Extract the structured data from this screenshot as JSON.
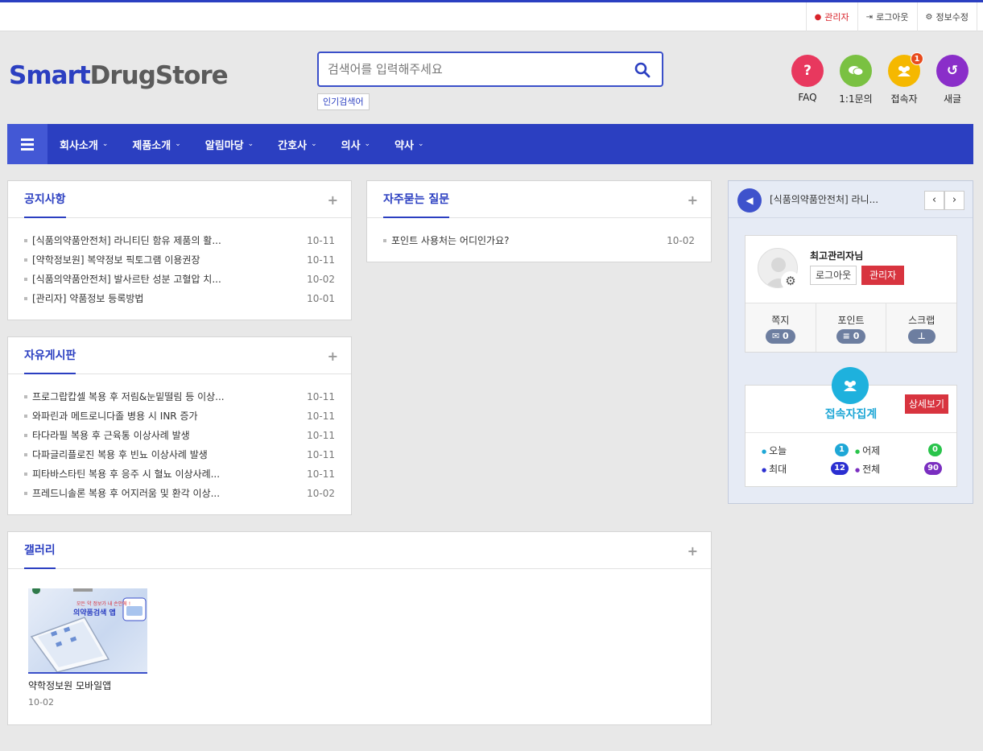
{
  "topbar": {
    "admin": "관리자",
    "logout": "로그아웃",
    "edit": "정보수정"
  },
  "logo": {
    "part1": "Smart",
    "part2": "DrugStore"
  },
  "search": {
    "placeholder": "검색어를 입력해주세요",
    "popular": "인기검색어"
  },
  "quick": [
    {
      "label": "FAQ",
      "glyph": "?",
      "color": "#e8385e"
    },
    {
      "label": "1:1문의",
      "glyph": "…",
      "color": "#7ac142"
    },
    {
      "label": "접속자",
      "glyph": "●●",
      "color": "#f5b800",
      "badge": "1"
    },
    {
      "label": "새글",
      "glyph": "↺",
      "color": "#8a2ec9"
    }
  ],
  "nav": {
    "items": [
      "회사소개",
      "제품소개",
      "알림마당",
      "간호사",
      "의사",
      "약사"
    ]
  },
  "notice": {
    "title": "공지사항",
    "rows": [
      {
        "t": "[식품의약품안전처] 라니티딘 함유 제품의 활...",
        "d": "10-11"
      },
      {
        "t": "[약학정보원] 복약정보 픽토그램 이용권장",
        "d": "10-11"
      },
      {
        "t": "[식품의약품안전처] 발사르탄 성분 고혈압 치...",
        "d": "10-02"
      },
      {
        "t": "[관리자] 약품정보 등록방법",
        "d": "10-01"
      }
    ]
  },
  "faq": {
    "title": "자주묻는 질문",
    "rows": [
      {
        "t": "포인트 사용처는 어디인가요?",
        "d": "10-02"
      }
    ]
  },
  "free": {
    "title": "자유게시판",
    "rows": [
      {
        "t": "프로그랍캅셀 복용 후 저림&눈밑떨림 등 이상...",
        "d": "10-11"
      },
      {
        "t": "와파린과 메트로니다졸 병용 시 INR 증가",
        "d": "10-11"
      },
      {
        "t": "타다라필 복용 후 근육통 이상사례 발생",
        "d": "10-11"
      },
      {
        "t": "다파글리플로진 복용 후 빈뇨 이상사례 발생",
        "d": "10-11"
      },
      {
        "t": "피타바스타틴 복용 후 응주 시 혈뇨 이상사례...",
        "d": "10-11"
      },
      {
        "t": "프레드니솔론 복용 후 어지러움 및 환각 이상...",
        "d": "10-02"
      }
    ]
  },
  "gallery": {
    "title": "갤러리",
    "item": {
      "caption": "약학정보원 모바일앱",
      "date": "10-02",
      "img_text1": "모든 약 정보가 내 손안에 !",
      "img_text2": "의약품검색 앱"
    }
  },
  "side": {
    "ticker": "[식품의약품안전처] 라니...",
    "prev": "‹",
    "next": "›",
    "profile": {
      "name": "최고관리자님",
      "logout": "로그아웃",
      "admin": "관리자",
      "stats": [
        {
          "label": "쪽지",
          "value": "0",
          "icon": "✉"
        },
        {
          "label": "포인트",
          "value": "0",
          "icon": "≡"
        },
        {
          "label": "스크랩",
          "value": "",
          "icon": "⊥"
        }
      ]
    },
    "visitors": {
      "title": "접속자집계",
      "more": "상세보기",
      "today_label": "오늘",
      "today": "1",
      "today_color": "#1ea7d6",
      "yesterday_label": "어제",
      "yesterday": "0",
      "yesterday_color": "#29c44b",
      "max_label": "최대",
      "max": "12",
      "max_color": "#2b2fd1",
      "total_label": "전체",
      "total": "90",
      "total_color": "#7a2ec0"
    }
  }
}
